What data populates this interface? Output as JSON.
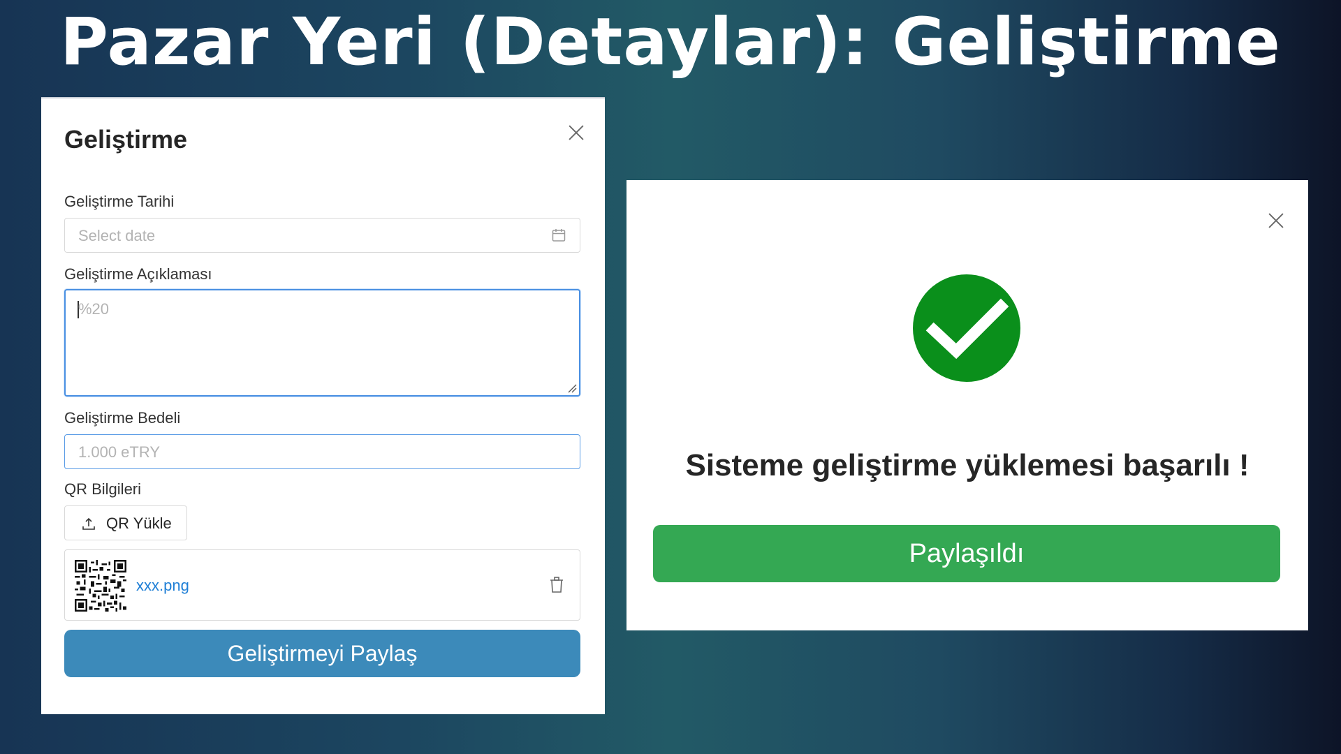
{
  "slide": {
    "title": "Pazar Yeri (Detaylar): Geliştirme"
  },
  "form_modal": {
    "title": "Geliştirme",
    "date_field": {
      "label": "Geliştirme Tarihi",
      "placeholder": "Select date",
      "icon": "calendar-icon"
    },
    "description_field": {
      "label": "Geliştirme Açıklaması",
      "placeholder": "%20"
    },
    "cost_field": {
      "label": "Geliştirme Bedeli",
      "placeholder": "1.000 eTRY"
    },
    "qr_section": {
      "label": "QR Bilgileri",
      "upload_button": "QR Yükle",
      "file": {
        "name": "xxx.png"
      }
    },
    "submit_button": "Geliştirmeyi Paylaş",
    "colors": {
      "primary": "#3c8aba",
      "link": "#1f7fd6",
      "focus": "#4a90e2"
    }
  },
  "success_modal": {
    "message": "Sisteme geliştirme yüklemesi başarılı !",
    "button": "Paylaşıldı",
    "colors": {
      "success_icon": "#0a8f1b",
      "button": "#34a853"
    }
  }
}
